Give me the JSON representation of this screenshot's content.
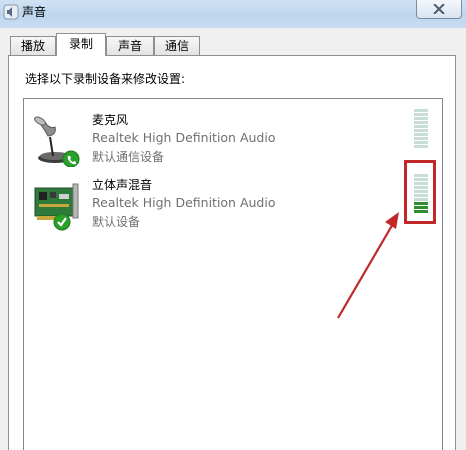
{
  "window": {
    "title": "声音",
    "icon": "speaker-icon"
  },
  "tabs": [
    {
      "label": "播放"
    },
    {
      "label": "录制"
    },
    {
      "label": "声音"
    },
    {
      "label": "通信"
    }
  ],
  "active_tab": "录制",
  "instruction": "选择以下录制设备来修改设置:",
  "devices": [
    {
      "name": "麦克风",
      "description": "Realtek High Definition Audio",
      "status": "默认通信设备",
      "icon": "microphone-icon",
      "badge": "phone-badge-icon",
      "level_segments_on": 0,
      "level_segments_total": 10
    },
    {
      "name": "立体声混音",
      "description": "Realtek High Definition Audio",
      "status": "默认设备",
      "icon": "sound-card-icon",
      "badge": "checkmark-badge-icon",
      "level_segments_on": 3,
      "level_segments_total": 10
    }
  ],
  "colors": {
    "annotation_red": "#c0282a",
    "meter_on": "#2f8f2f",
    "meter_off": "#c7ddd6",
    "badge_green": "#2aa12a"
  }
}
